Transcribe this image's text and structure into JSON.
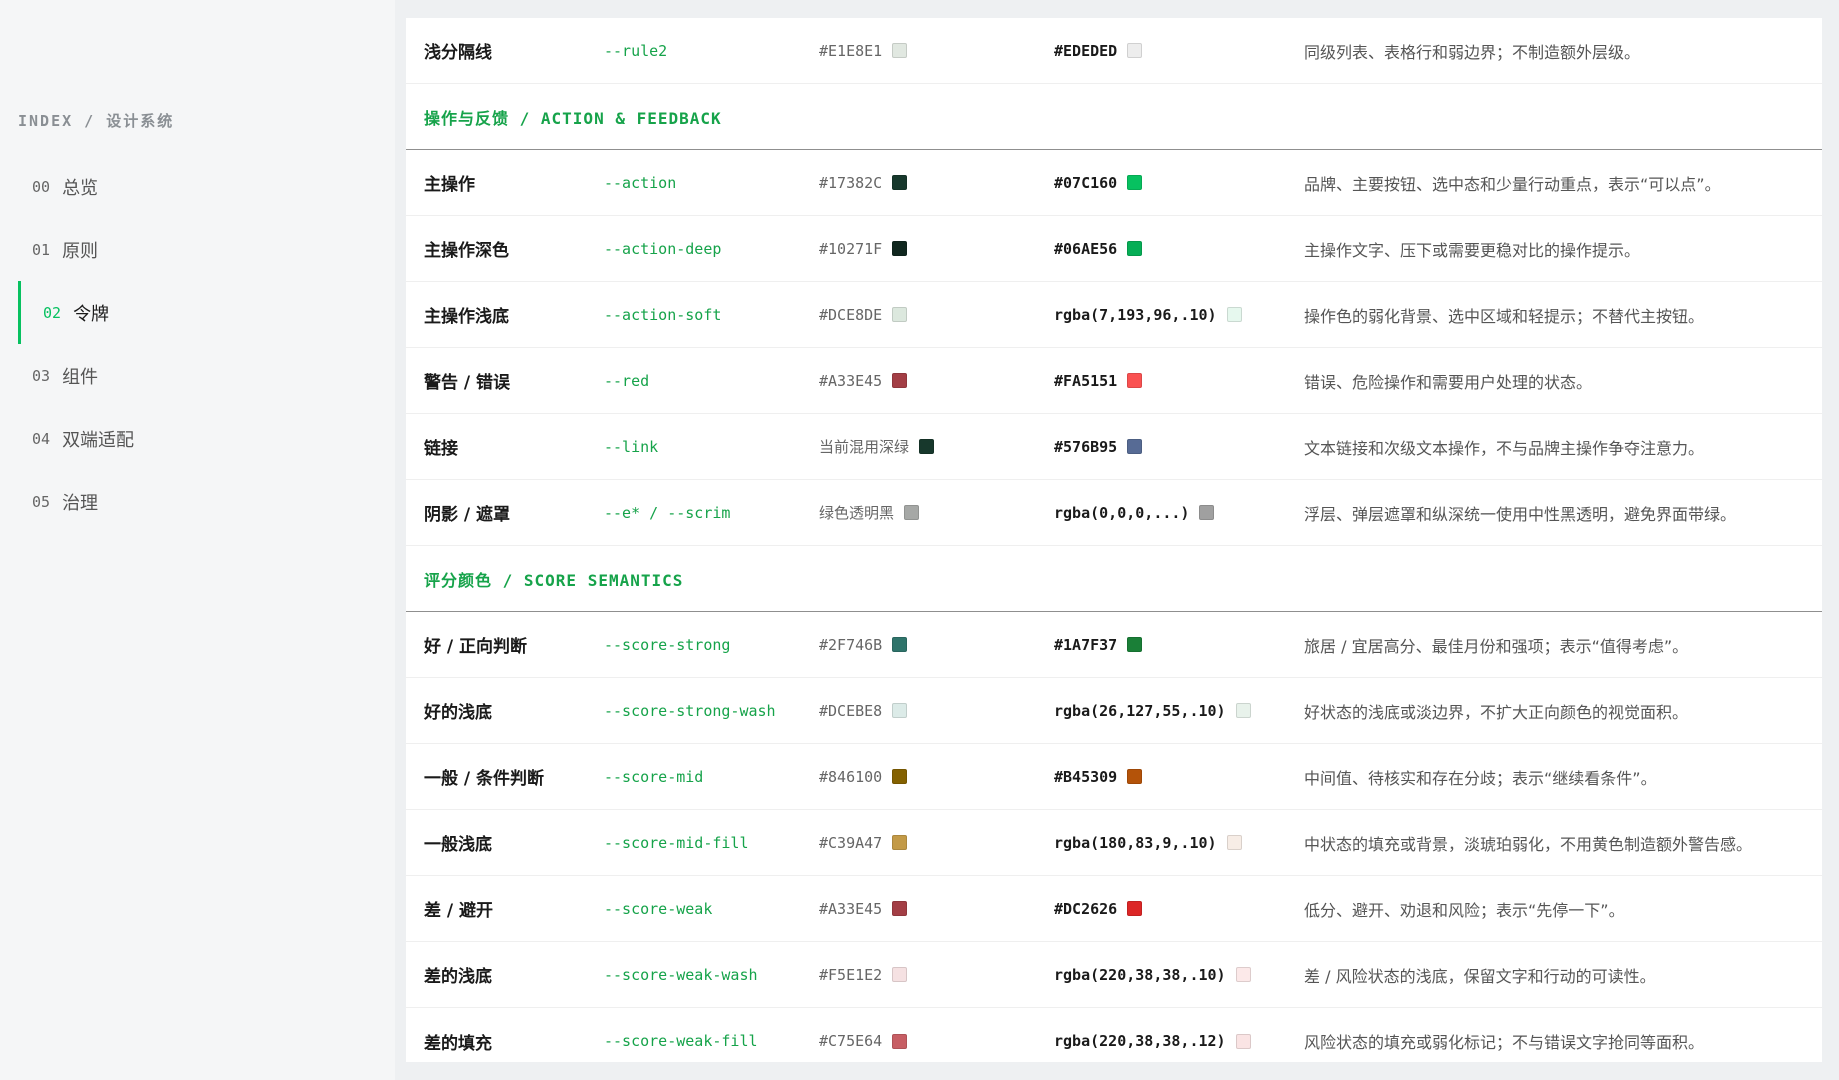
{
  "sidebar": {
    "title": "INDEX / 设计系统",
    "items": [
      {
        "num": "00",
        "label": "总览"
      },
      {
        "num": "01",
        "label": "原则"
      },
      {
        "num": "02",
        "label": "令牌"
      },
      {
        "num": "03",
        "label": "组件"
      },
      {
        "num": "04",
        "label": "双端适配"
      },
      {
        "num": "05",
        "label": "治理"
      }
    ],
    "active_index": 2
  },
  "rows_top": [
    {
      "name": "浅分隔线",
      "var": "--rule2",
      "old": "#E1E8E1",
      "old_color": "#E1E8E1",
      "new": "#EDEDED",
      "new_color": "#EDEDED",
      "desc": "同级列表、表格行和弱边界；不制造额外层级。"
    }
  ],
  "section_action": {
    "title": "操作与反馈 / ACTION & FEEDBACK",
    "rows": [
      {
        "name": "主操作",
        "var": "--action",
        "old": "#17382C",
        "old_color": "#17382C",
        "new": "#07C160",
        "new_color": "#07C160",
        "desc": "品牌、主要按钮、选中态和少量行动重点，表示“可以点”。"
      },
      {
        "name": "主操作深色",
        "var": "--action-deep",
        "old": "#10271F",
        "old_color": "#10271F",
        "new": "#06AE56",
        "new_color": "#06AE56",
        "desc": "主操作文字、压下或需要更稳对比的操作提示。"
      },
      {
        "name": "主操作浅底",
        "var": "--action-soft",
        "old": "#DCE8DE",
        "old_color": "#DCE8DE",
        "new": "rgba(7,193,96,.10)",
        "new_color": "#E6F8EE",
        "desc": "操作色的弱化背景、选中区域和轻提示；不替代主按钮。"
      },
      {
        "name": "警告 / 错误",
        "var": "--red",
        "old": "#A33E45",
        "old_color": "#A33E45",
        "new": "#FA5151",
        "new_color": "#FA5151",
        "desc": "错误、危险操作和需要用户处理的状态。"
      },
      {
        "name": "链接",
        "var": "--link",
        "old": "当前混用深绿",
        "old_color": "#17382C",
        "new": "#576B95",
        "new_color": "#576B95",
        "desc": "文本链接和次级文本操作，不与品牌主操作争夺注意力。"
      },
      {
        "name": "阴影 / 遮罩",
        "var": "--e* / --scrim",
        "old": "绿色透明黑",
        "old_color": "#A6A8A6",
        "new": "rgba(0,0,0,...)",
        "new_color": "#A0A0A0",
        "desc": "浮层、弹层遮罩和纵深统一使用中性黑透明，避免界面带绿。"
      }
    ]
  },
  "section_score": {
    "title": "评分颜色 / SCORE SEMANTICS",
    "rows": [
      {
        "name": "好 / 正向判断",
        "var": "--score-strong",
        "old": "#2F746B",
        "old_color": "#2F746B",
        "new": "#1A7F37",
        "new_color": "#1A7F37",
        "desc": "旅居 / 宜居高分、最佳月份和强项；表示“值得考虑”。"
      },
      {
        "name": "好的浅底",
        "var": "--score-strong-wash",
        "old": "#DCEBE8",
        "old_color": "#DCEBE8",
        "new": "rgba(26,127,55,.10)",
        "new_color": "#E8F2EB",
        "desc": "好状态的浅底或淡边界，不扩大正向颜色的视觉面积。"
      },
      {
        "name": "一般 / 条件判断",
        "var": "--score-mid",
        "old": "#846100",
        "old_color": "#846100",
        "new": "#B45309",
        "new_color": "#B45309",
        "desc": "中间值、待核实和存在分歧；表示“继续看条件”。"
      },
      {
        "name": "一般浅底",
        "var": "--score-mid-fill",
        "old": "#C39A47",
        "old_color": "#C39A47",
        "new": "rgba(180,83,9,.10)",
        "new_color": "#F7EDE6",
        "desc": "中状态的填充或背景，淡琥珀弱化，不用黄色制造额外警告感。"
      },
      {
        "name": "差 / 避开",
        "var": "--score-weak",
        "old": "#A33E45",
        "old_color": "#A33E45",
        "new": "#DC2626",
        "new_color": "#DC2626",
        "desc": "低分、避开、劝退和风险；表示“先停一下”。"
      },
      {
        "name": "差的浅底",
        "var": "--score-weak-wash",
        "old": "#F5E1E2",
        "old_color": "#F5E1E2",
        "new": "rgba(220,38,38,.10)",
        "new_color": "#FCE9E9",
        "desc": "差 / 风险状态的浅底，保留文字和行动的可读性。"
      },
      {
        "name": "差的填充",
        "var": "--score-weak-fill",
        "old": "#C75E64",
        "old_color": "#C75E64",
        "new": "rgba(220,38,38,.12)",
        "new_color": "#FAE4E4",
        "desc": "风险状态的填充或弱化标记；不与错误文字抢同等面积。"
      }
    ]
  }
}
